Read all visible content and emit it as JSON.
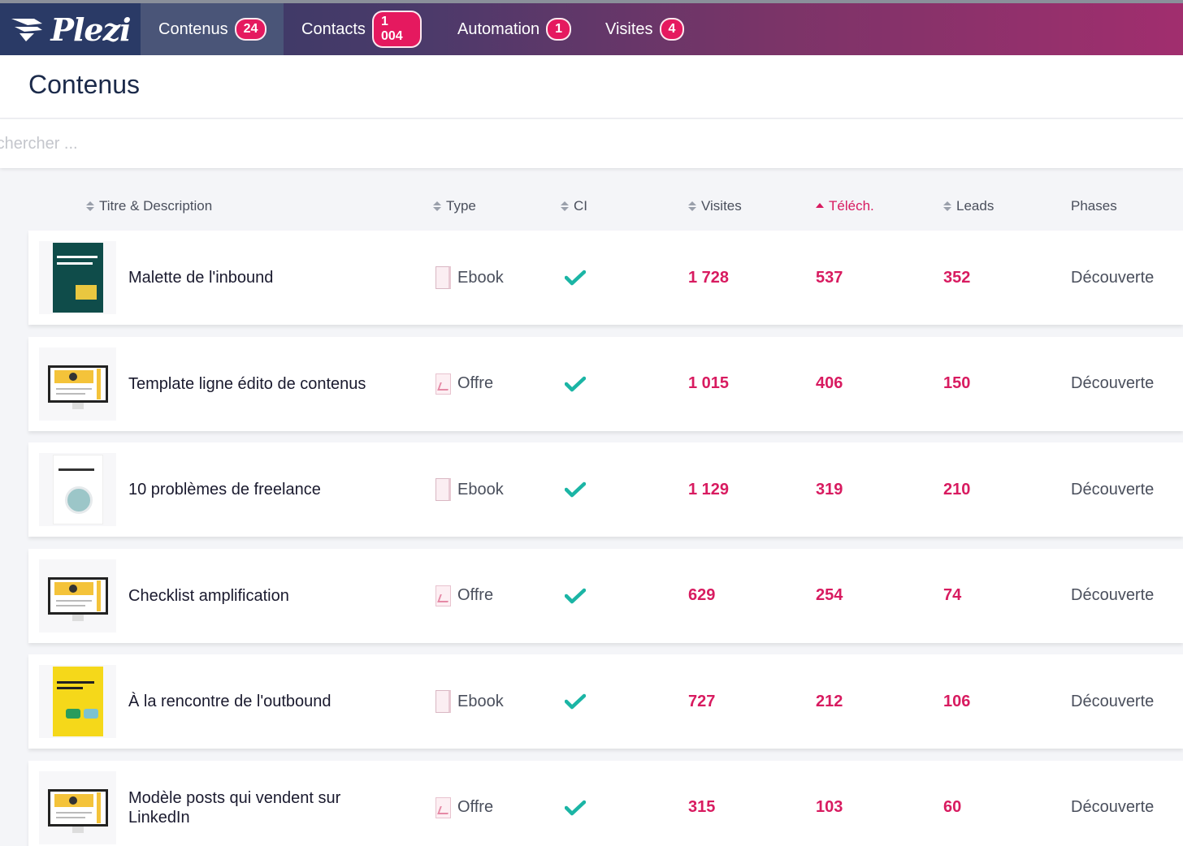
{
  "nav": {
    "logo_text": "Plezi",
    "items": [
      {
        "label": "Contenus",
        "count": "24"
      },
      {
        "label": "Contacts",
        "count": "1 004"
      },
      {
        "label": "Automation",
        "count": "1"
      },
      {
        "label": "Visites",
        "count": "4"
      }
    ]
  },
  "page": {
    "title": "Contenus",
    "search_placeholder": "Rechercher ..."
  },
  "table": {
    "columns": {
      "title": "Titre & Description",
      "type": "Type",
      "ci": "CI",
      "visits": "Visites",
      "downloads": "Téléch.",
      "leads": "Leads",
      "phases": "Phases"
    },
    "sorted_column": "downloads",
    "rows": [
      {
        "title": "Malette de l'inbound",
        "type": "Ebook",
        "thumb": "dark-ebook",
        "visits": "1 728",
        "downloads": "537",
        "leads": "352",
        "phase": "Découverte"
      },
      {
        "title": "Template ligne édito de contenus",
        "type": "Offre",
        "thumb": "screen",
        "visits": "1 015",
        "downloads": "406",
        "leads": "150",
        "phase": "Découverte"
      },
      {
        "title": "10 problèmes de freelance",
        "type": "Ebook",
        "thumb": "white-ebook",
        "visits": "1 129",
        "downloads": "319",
        "leads": "210",
        "phase": "Découverte"
      },
      {
        "title": "Checklist amplification",
        "type": "Offre",
        "thumb": "screen",
        "visits": "629",
        "downloads": "254",
        "leads": "74",
        "phase": "Découverte"
      },
      {
        "title": "À la rencontre de l'outbound",
        "type": "Ebook",
        "thumb": "yellow-ebook",
        "visits": "727",
        "downloads": "212",
        "leads": "106",
        "phase": "Découverte"
      },
      {
        "title": "Modèle posts qui vendent sur LinkedIn",
        "type": "Offre",
        "thumb": "screen",
        "visits": "315",
        "downloads": "103",
        "leads": "60",
        "phase": "Découverte"
      }
    ]
  },
  "colors": {
    "accent": "#d81b60",
    "check": "#1bb5a5",
    "badge": "#e5195f"
  }
}
